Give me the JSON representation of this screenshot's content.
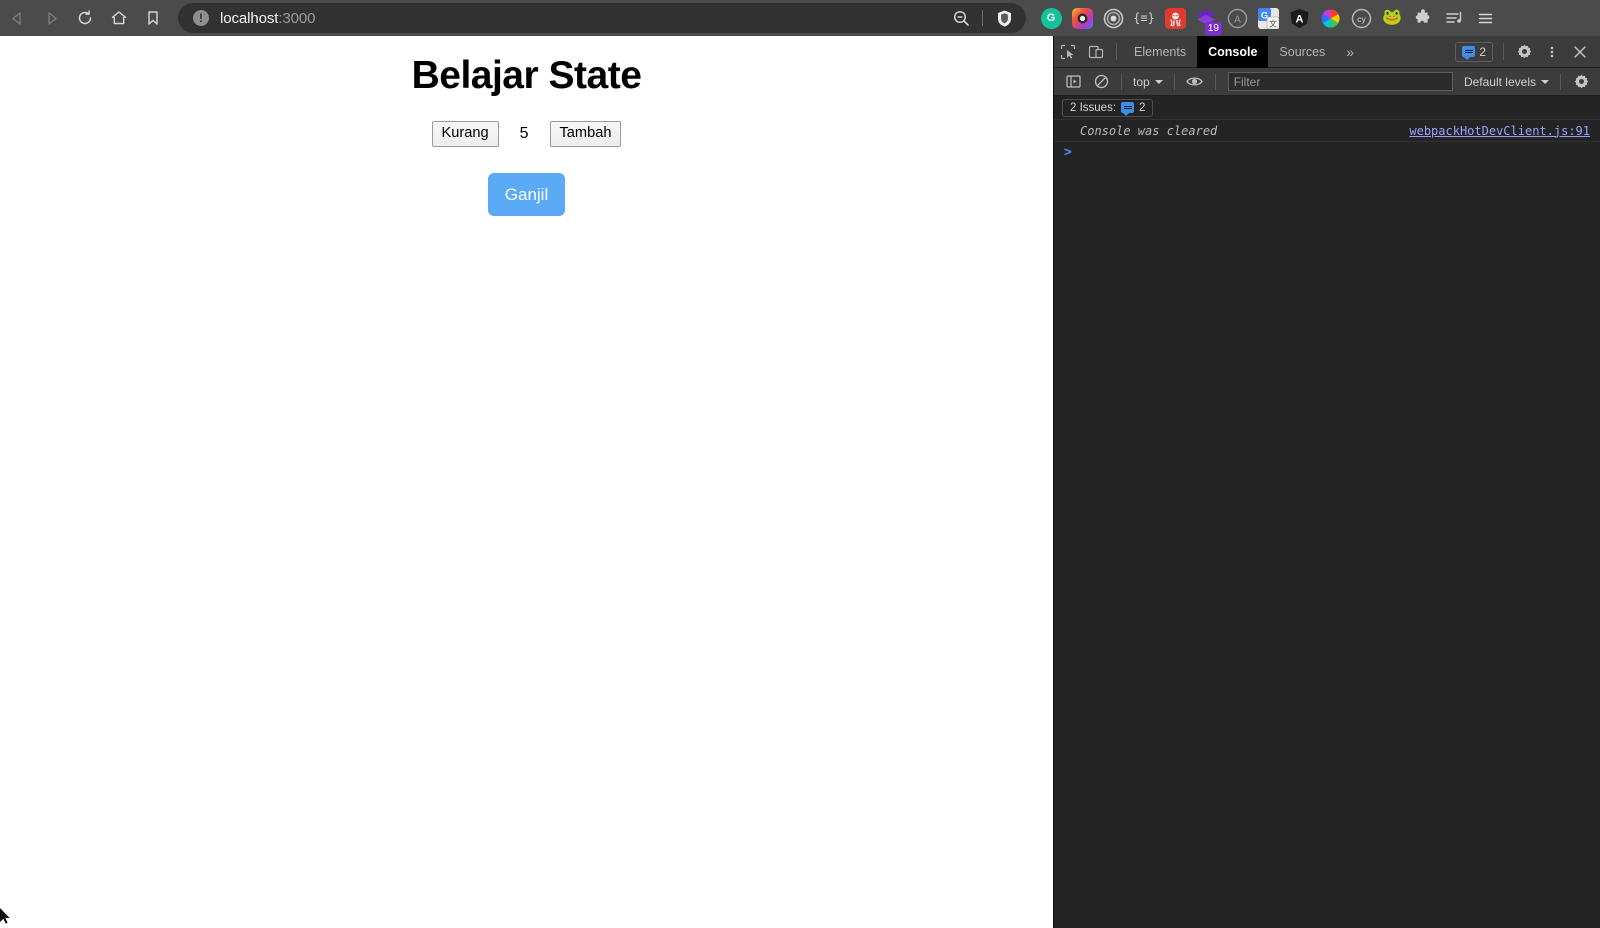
{
  "browser": {
    "nav": [
      {
        "name": "back-button",
        "icon": "arrow-left-icon",
        "disabled": true
      },
      {
        "name": "forward-button",
        "icon": "arrow-right-icon",
        "disabled": true
      },
      {
        "name": "reload-button",
        "icon": "reload-icon",
        "disabled": false
      },
      {
        "name": "home-button",
        "icon": "home-icon",
        "disabled": false
      },
      {
        "name": "bookmark-button",
        "icon": "bookmark-icon",
        "disabled": false
      }
    ],
    "omnibox": {
      "site_info_icon": "not-secure-info-icon",
      "host": "localhost",
      "port": ":3000",
      "zoom_icon": "zoom-out-magnifier-icon",
      "shields_icon": "brave-shields-lion-icon"
    },
    "extensions": [
      {
        "name": "grammarly-extension-icon",
        "label": "G",
        "bg": "#15c39a",
        "shape": "circle"
      },
      {
        "name": "screenshot-camera-extension-icon",
        "label": "",
        "bg": "#e8562f",
        "shape": "square"
      },
      {
        "name": "target-rings-extension-icon",
        "label": "",
        "bg": "#808080",
        "shape": "circle"
      },
      {
        "name": "json-formatter-extension-icon",
        "label": "{≡}",
        "bg": "transparent",
        "shape": "plain"
      },
      {
        "name": "octopus-red-extension-icon",
        "label": "",
        "bg": "#e03a2f",
        "shape": "square"
      },
      {
        "name": "purple-stack-extension-icon",
        "label": "",
        "bg": "#7a2fd6",
        "shape": "diamond",
        "badge": "19"
      },
      {
        "name": "gray-a-extension-icon",
        "label": "A",
        "bg": "#9a9a9a",
        "shape": "circle"
      },
      {
        "name": "google-translate-extension-icon",
        "label": "G",
        "bg": "#4285f4",
        "shape": "square"
      },
      {
        "name": "angular-extension-icon",
        "label": "A",
        "bg": "#1c1c1c",
        "shape": "shield"
      },
      {
        "name": "color-picker-extension-icon",
        "label": "",
        "bg": "#ff3b30",
        "shape": "colorwheel"
      },
      {
        "name": "cypress-extension-icon",
        "label": "cy",
        "bg": "#3a3a3a",
        "shape": "circle"
      },
      {
        "name": "frog-extension-icon",
        "label": "🐸",
        "bg": "transparent",
        "shape": "plain"
      },
      {
        "name": "extensions-puzzle-icon",
        "label": "",
        "bg": "transparent",
        "shape": "puzzle"
      },
      {
        "name": "media-playlist-icon",
        "label": "",
        "bg": "transparent",
        "shape": "playlist"
      },
      {
        "name": "browser-menu-icon",
        "label": "",
        "bg": "transparent",
        "shape": "hamburger"
      }
    ]
  },
  "page": {
    "title": "Belajar State",
    "decrement_label": "Kurang",
    "counter_value": "5",
    "increment_label": "Tambah",
    "parity_label": "Ganjil",
    "parity_color": "#5aaaf5"
  },
  "devtools": {
    "tools": [
      {
        "name": "inspect-element-icon"
      },
      {
        "name": "device-toolbar-icon"
      }
    ],
    "tabs": [
      {
        "label": "Elements",
        "active": false
      },
      {
        "label": "Console",
        "active": true
      },
      {
        "label": "Sources",
        "active": false
      }
    ],
    "more_tabs_label": "»",
    "issue_badge_count": "2",
    "settings_icon": "gear-icon",
    "kebab_icon": "more-vertical-icon",
    "close_icon": "close-icon",
    "console_toolbar": {
      "sidebar_toggle_icon": "console-sidebar-icon",
      "clear_icon": "clear-console-icon",
      "context_label": "top",
      "eye_icon": "live-expression-eye-icon",
      "filter_placeholder": "Filter",
      "filter_value": "",
      "levels_label": "Default levels",
      "settings_icon": "gear-icon"
    },
    "issues_bar": {
      "label": "2 Issues:",
      "count": "2"
    },
    "log_entries": [
      {
        "message": "Console was cleared",
        "source": "webpackHotDevClient.js:91"
      }
    ],
    "prompt_caret": ">"
  }
}
